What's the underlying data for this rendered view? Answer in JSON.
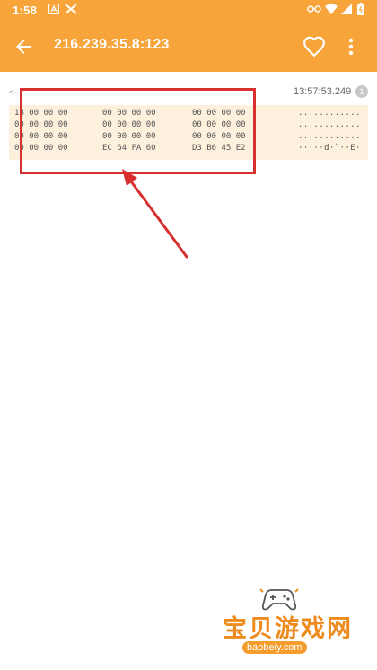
{
  "status": {
    "time": "1:58"
  },
  "appbar": {
    "title": "216.239.35.8:123"
  },
  "packet": {
    "direction": "<-",
    "timestamp": "13:57:53.249",
    "count": "1",
    "rows": [
      {
        "g1": "1B 00 00 00",
        "g2": "00 00 00 00",
        "g3": "00 00 00 00",
        "ascii": "............"
      },
      {
        "g1": "00 00 00 00",
        "g2": "00 00 00 00",
        "g3": "00 00 00 00",
        "ascii": "............"
      },
      {
        "g1": "00 00 00 00",
        "g2": "00 00 00 00",
        "g3": "00 00 00 00",
        "ascii": "............"
      },
      {
        "g1": "00 00 00 00",
        "g2": "EC 64 FA 60",
        "g3": "D3 B6 45 E2",
        "ascii": "·····d·`··E·"
      }
    ]
  },
  "watermark": {
    "chinese": "宝贝游戏网",
    "url": "baobeiy.com"
  },
  "colors": {
    "appbar": "#f7a53a",
    "highlight": "#d82f2f",
    "hex_background": "#fdf0dd"
  }
}
